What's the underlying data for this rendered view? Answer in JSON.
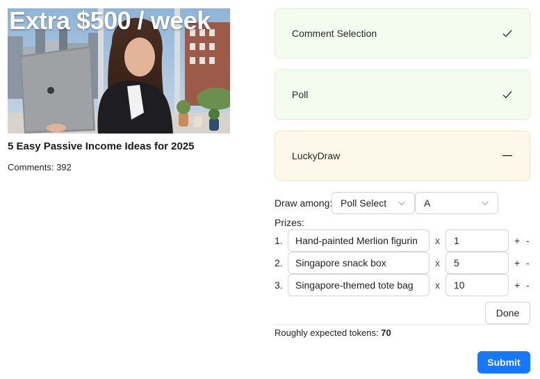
{
  "video": {
    "thumbnail_caption": "Extra $500 / week",
    "title": "5 Easy Passive Income Ideas for 2025",
    "comments_label": "Comments: 392"
  },
  "steps": [
    {
      "label": "Comment Selection",
      "status": "done",
      "icon": "check-icon"
    },
    {
      "label": "Poll",
      "status": "done",
      "icon": "check-icon"
    },
    {
      "label": "LuckyDraw",
      "status": "active",
      "icon": "minus-icon"
    }
  ],
  "draw": {
    "label": "Draw among:",
    "source_select": "Poll Select",
    "option_select": "A"
  },
  "prizes": {
    "label": "Prizes:",
    "times_symbol": "x",
    "plus_symbol": "+",
    "minus_symbol": "-",
    "items": [
      {
        "num": "1.",
        "name": "Hand-painted Merlion figurin",
        "qty": "1"
      },
      {
        "num": "2.",
        "name": "Singapore snack box",
        "qty": "5"
      },
      {
        "num": "3.",
        "name": "Singapore-themed tote bag",
        "qty": "10"
      }
    ]
  },
  "done_label": "Done",
  "tokens": {
    "label": "Roughly expected tokens:",
    "value": "70"
  },
  "submit_label": "Submit",
  "colors": {
    "done_panel_bg": "#f4fcef",
    "active_panel_bg": "#fdf8e9",
    "primary": "#1677ff"
  }
}
